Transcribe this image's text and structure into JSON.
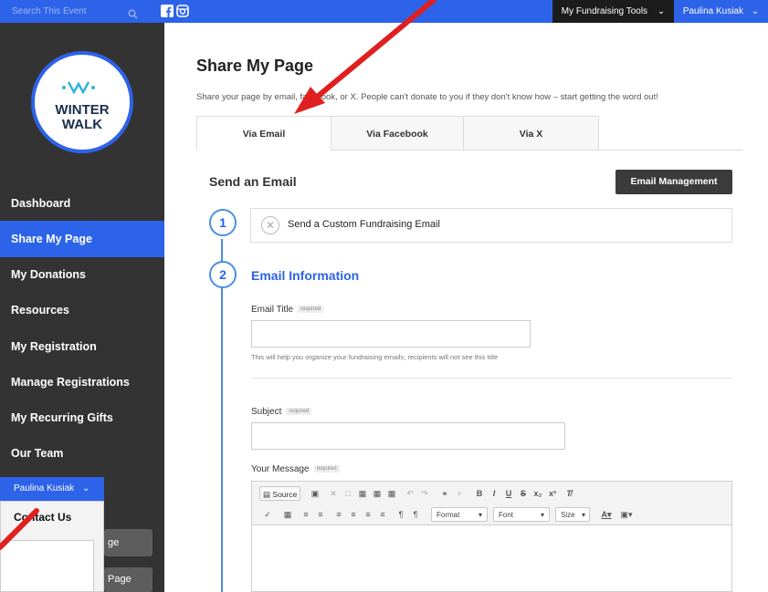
{
  "topbar": {
    "search_placeholder": "Search This Event",
    "tools_label": "My Fundraising Tools",
    "user_label": "Paulina Kusiak",
    "chevron": "⌄"
  },
  "logo": {
    "mark": "·\\/\\/\\·",
    "line1": "WINTER",
    "line2": "WALK"
  },
  "sidebar": {
    "items": [
      {
        "label": "Dashboard"
      },
      {
        "label": "Share My Page"
      },
      {
        "label": "My Donations"
      },
      {
        "label": "Resources"
      },
      {
        "label": "My Registration"
      },
      {
        "label": "Manage Registrations"
      },
      {
        "label": "My Recurring Gifts"
      },
      {
        "label": "Our Team"
      }
    ]
  },
  "overlay": {
    "user_label": "Paulina Kusiak",
    "item": "Contact Us",
    "btn1": "ge",
    "btn2": "Page"
  },
  "main": {
    "title": "Share My Page",
    "subtitle": "Share your page by email, facebook, or X. People can't donate to you if they don't know how – start getting the word out!",
    "tabs": [
      {
        "label": "Via Email"
      },
      {
        "label": "Via Facebook"
      },
      {
        "label": "Via X"
      }
    ],
    "send_title": "Send an Email",
    "email_mgmt": "Email Management",
    "step1_num": "1",
    "step1_label": "Send a Custom Fundraising Email",
    "step2_num": "2",
    "step2_title": "Email Information",
    "email_title_label": "Email Title",
    "required": "required",
    "email_title_help": "This will help you organize your fundraising emails; recipients will not see this title",
    "subject_label": "Subject",
    "message_label": "Your Message",
    "toolbar": {
      "source": "Source",
      "format": "Format",
      "font": "Font",
      "size": "Size"
    }
  },
  "colors": {
    "accent": "#2d63e8",
    "sidebar": "#333333",
    "arrow": "#e02020"
  }
}
